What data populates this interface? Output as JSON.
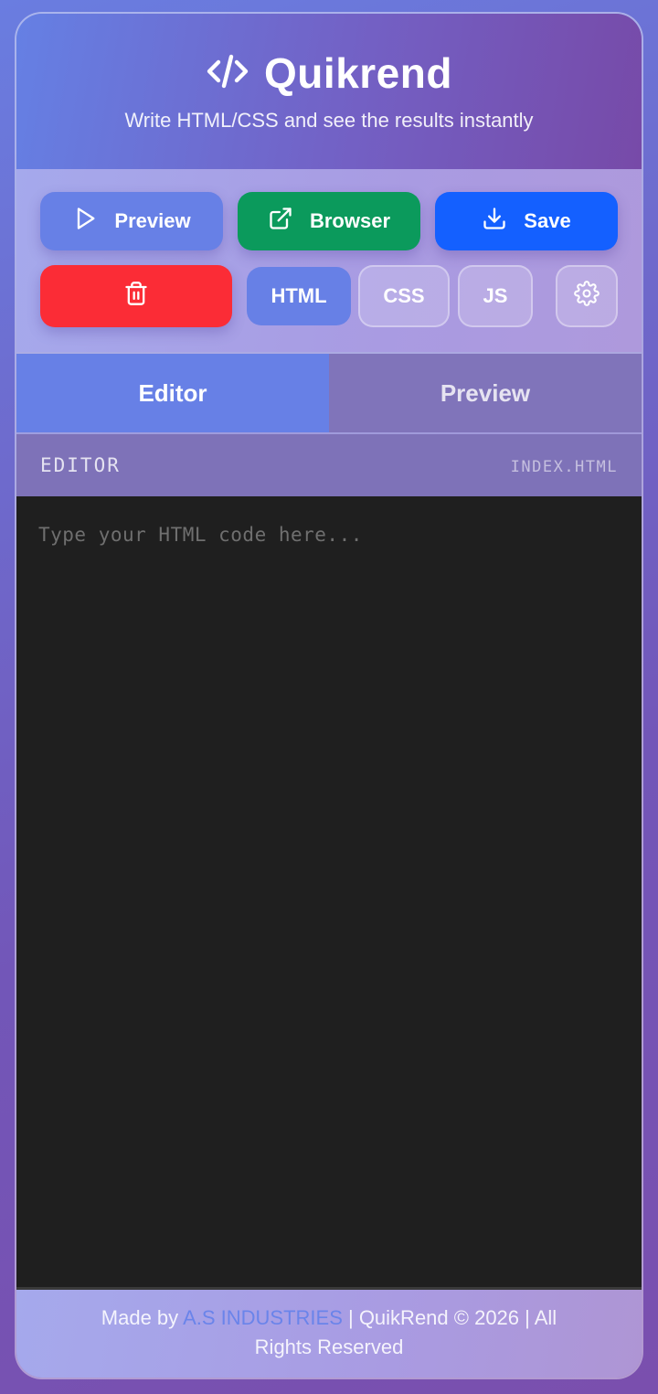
{
  "header": {
    "title": "Quikrend",
    "subtitle": "Write HTML/CSS and see the results instantly",
    "logo_icon": "code-icon"
  },
  "toolbar": {
    "preview_label": "Preview",
    "browser_label": "Browser",
    "save_label": "Save",
    "delete_icon": "trash-icon",
    "settings_icon": "gear-icon",
    "languages": [
      "HTML",
      "CSS",
      "JS"
    ],
    "active_language": "HTML",
    "colors": {
      "preview": "#6780e6",
      "browser": "#0b9a5c",
      "save": "#1460ff",
      "delete": "#fb2c36"
    }
  },
  "tabs": [
    {
      "label": "Editor",
      "active": true
    },
    {
      "label": "Preview",
      "active": false
    }
  ],
  "editor": {
    "label": "EDITOR",
    "file": "INDEX.HTML",
    "value": "",
    "placeholder": "Type your HTML code here..."
  },
  "footer": {
    "prefix": "Made by ",
    "link_text": "A.S INDUSTRIES",
    "suffix": " | QuikRend © 2026 | All Rights Reserved"
  }
}
